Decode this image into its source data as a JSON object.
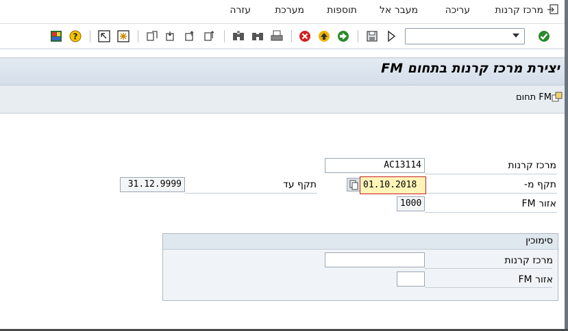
{
  "menu": {
    "items": [
      "מרכז קרנות",
      "עריכה",
      "מעבר אל",
      "תוספות",
      "מערכת",
      "עזרה"
    ]
  },
  "toolbar": {
    "command_field_value": "",
    "icons": [
      "customize-layout-icon",
      "help-icon",
      "generate-shortcut-icon",
      "new-session-icon",
      "last-page-icon",
      "next-page-icon",
      "previous-page-icon",
      "first-page-icon",
      "find-next-icon",
      "find-icon",
      "print-icon",
      "cancel-icon",
      "exit-icon",
      "back-icon",
      "save-icon",
      "execute-icon",
      "enter-icon"
    ]
  },
  "title": "יצירת מרכז קרנות בתחום FM",
  "app_toolbar": {
    "fm_area_button": "תחום FM"
  },
  "form": {
    "fund_center_label": "מרכז קרנות",
    "fund_center_value": "AC13114",
    "valid_from_label": "תקף מ-",
    "valid_from_value": "01.10.2018",
    "valid_to_label": "תקף עד",
    "valid_to_value": "31.12.9999",
    "fm_area_label": "אזור FM",
    "fm_area_value": "1000"
  },
  "reference": {
    "title": "סימוכין",
    "fund_center_label": "מרכז קרנות",
    "fund_center_value": "",
    "fm_area_label": "אזור FM",
    "fm_area_value": ""
  }
}
